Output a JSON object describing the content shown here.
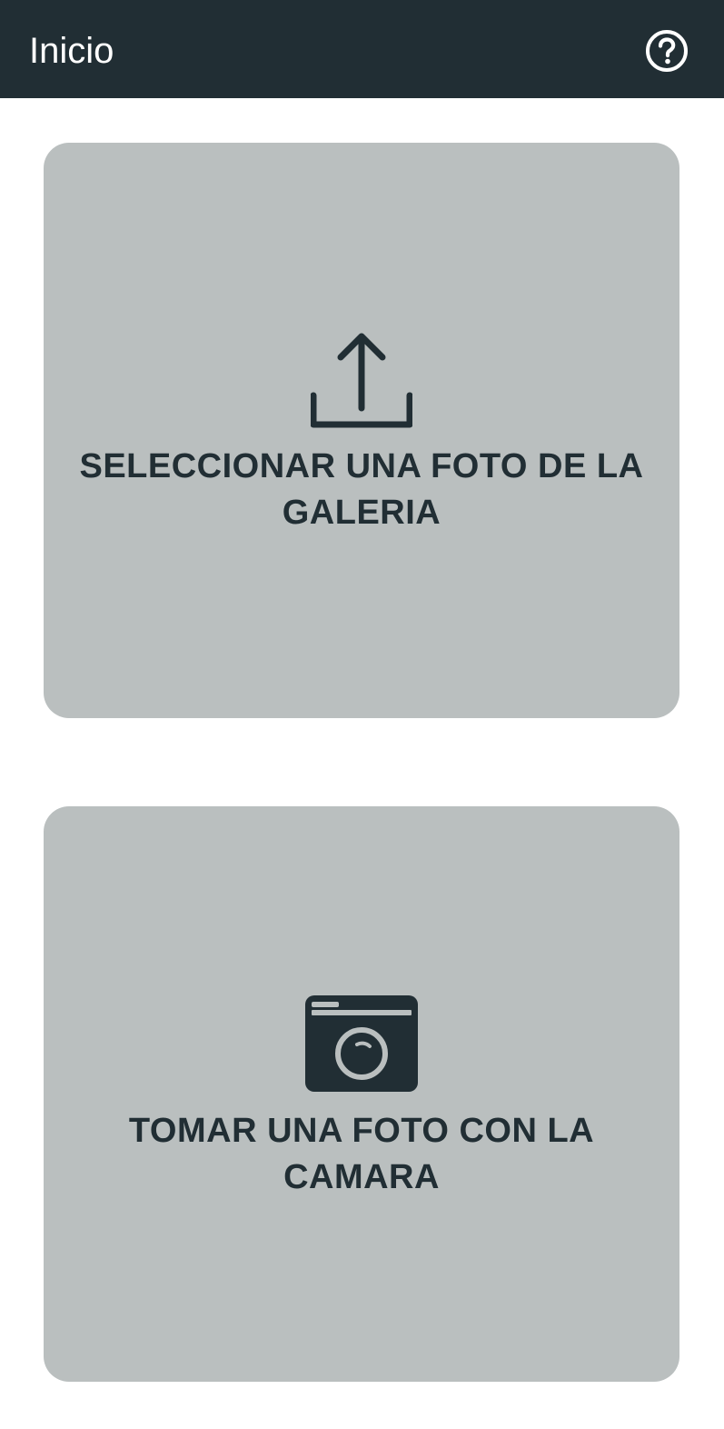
{
  "toolbar": {
    "title": "Inicio",
    "help_icon": "help-circle-icon"
  },
  "actions": {
    "gallery": {
      "icon": "upload-icon",
      "label": "SELECCIONAR UNA FOTO DE LA GALERIA"
    },
    "camera": {
      "icon": "camera-icon",
      "label": "TOMAR UNA FOTO CON LA CAMARA"
    }
  },
  "colors": {
    "toolbar_bg": "#212e34",
    "card_bg": "#babfbf",
    "text_dark": "#212e34",
    "text_light": "#ffffff"
  }
}
